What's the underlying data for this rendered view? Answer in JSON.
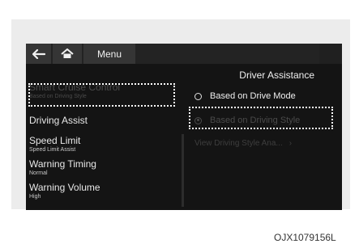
{
  "topbar": {
    "back_icon": "arrow-left-icon",
    "home_icon": "home-icon",
    "menu_label": "Menu"
  },
  "left_menu": [
    {
      "label": "Smart Cruise Control",
      "sub": "Based on Driving Style",
      "active": true
    },
    {
      "label": "Driving Assist",
      "sub": ""
    },
    {
      "label": "Speed Limit",
      "sub": "Speed Limit Assist"
    },
    {
      "label": "Warning Timing",
      "sub": "Normal"
    },
    {
      "label": "Warning Volume",
      "sub": "High"
    }
  ],
  "right_pane": {
    "title": "Driver Assistance",
    "options": [
      {
        "label": "Based on Drive Mode",
        "checked": false
      },
      {
        "label": "Based on Driving Style",
        "checked": true
      }
    ],
    "link_label": "View Driving Style Ana...",
    "link_icon": "chevron-right-icon"
  },
  "figure_code": "OJX1079156L"
}
